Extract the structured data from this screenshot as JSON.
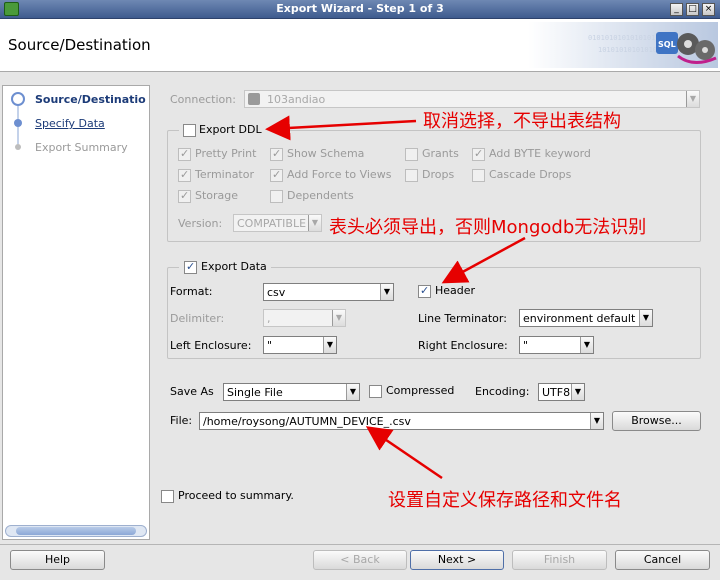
{
  "window": {
    "title": "Export Wizard - Step 1 of 3",
    "min": "_",
    "max": "□",
    "close": "×"
  },
  "header": {
    "title": "Source/Destination"
  },
  "nav": {
    "items": [
      {
        "label": "Source/Destinatio"
      },
      {
        "label": "Specify Data"
      },
      {
        "label": "Export Summary"
      }
    ]
  },
  "connection": {
    "label": "Connection:",
    "value": "103andiao"
  },
  "ddl": {
    "label": "Export DDL",
    "options": {
      "pretty_print": "Pretty Print",
      "show_schema": "Show Schema",
      "grants": "Grants",
      "add_byte": "Add BYTE keyword",
      "terminator": "Terminator",
      "add_force": "Add Force to Views",
      "drops": "Drops",
      "cascade_drops": "Cascade Drops",
      "storage": "Storage",
      "dependents": "Dependents"
    },
    "version_label": "Version:",
    "version_value": "COMPATIBLE"
  },
  "data": {
    "label": "Export Data",
    "format_label": "Format:",
    "format_value": "csv",
    "header_label": "Header",
    "delimiter_label": "Delimiter:",
    "delimiter_value": ",",
    "line_term_label": "Line Terminator:",
    "line_term_value": "environment default",
    "left_enc_label": "Left Enclosure:",
    "left_enc_value": "\"",
    "right_enc_label": "Right Enclosure:",
    "right_enc_value": "\""
  },
  "save": {
    "save_as_label": "Save As",
    "save_as_value": "Single File",
    "compressed_label": "Compressed",
    "encoding_label": "Encoding:",
    "encoding_value": "UTF8",
    "file_label": "File:",
    "file_value": "/home/roysong/AUTUMN_DEVICE_.csv",
    "browse_label": "Browse..."
  },
  "proceed_label": "Proceed to summary.",
  "buttons": {
    "help": "Help",
    "back": "< Back",
    "next": "Next >",
    "finish": "Finish",
    "cancel": "Cancel"
  },
  "annotations": {
    "ddl_note": "取消选择，不导出表结构",
    "header_note": "表头必须导出，否则Mongodb无法识别",
    "file_note": "设置自定义保存路径和文件名"
  },
  "colors": {
    "annotation": "#e60000",
    "titlebar": "#4f6a9c"
  }
}
